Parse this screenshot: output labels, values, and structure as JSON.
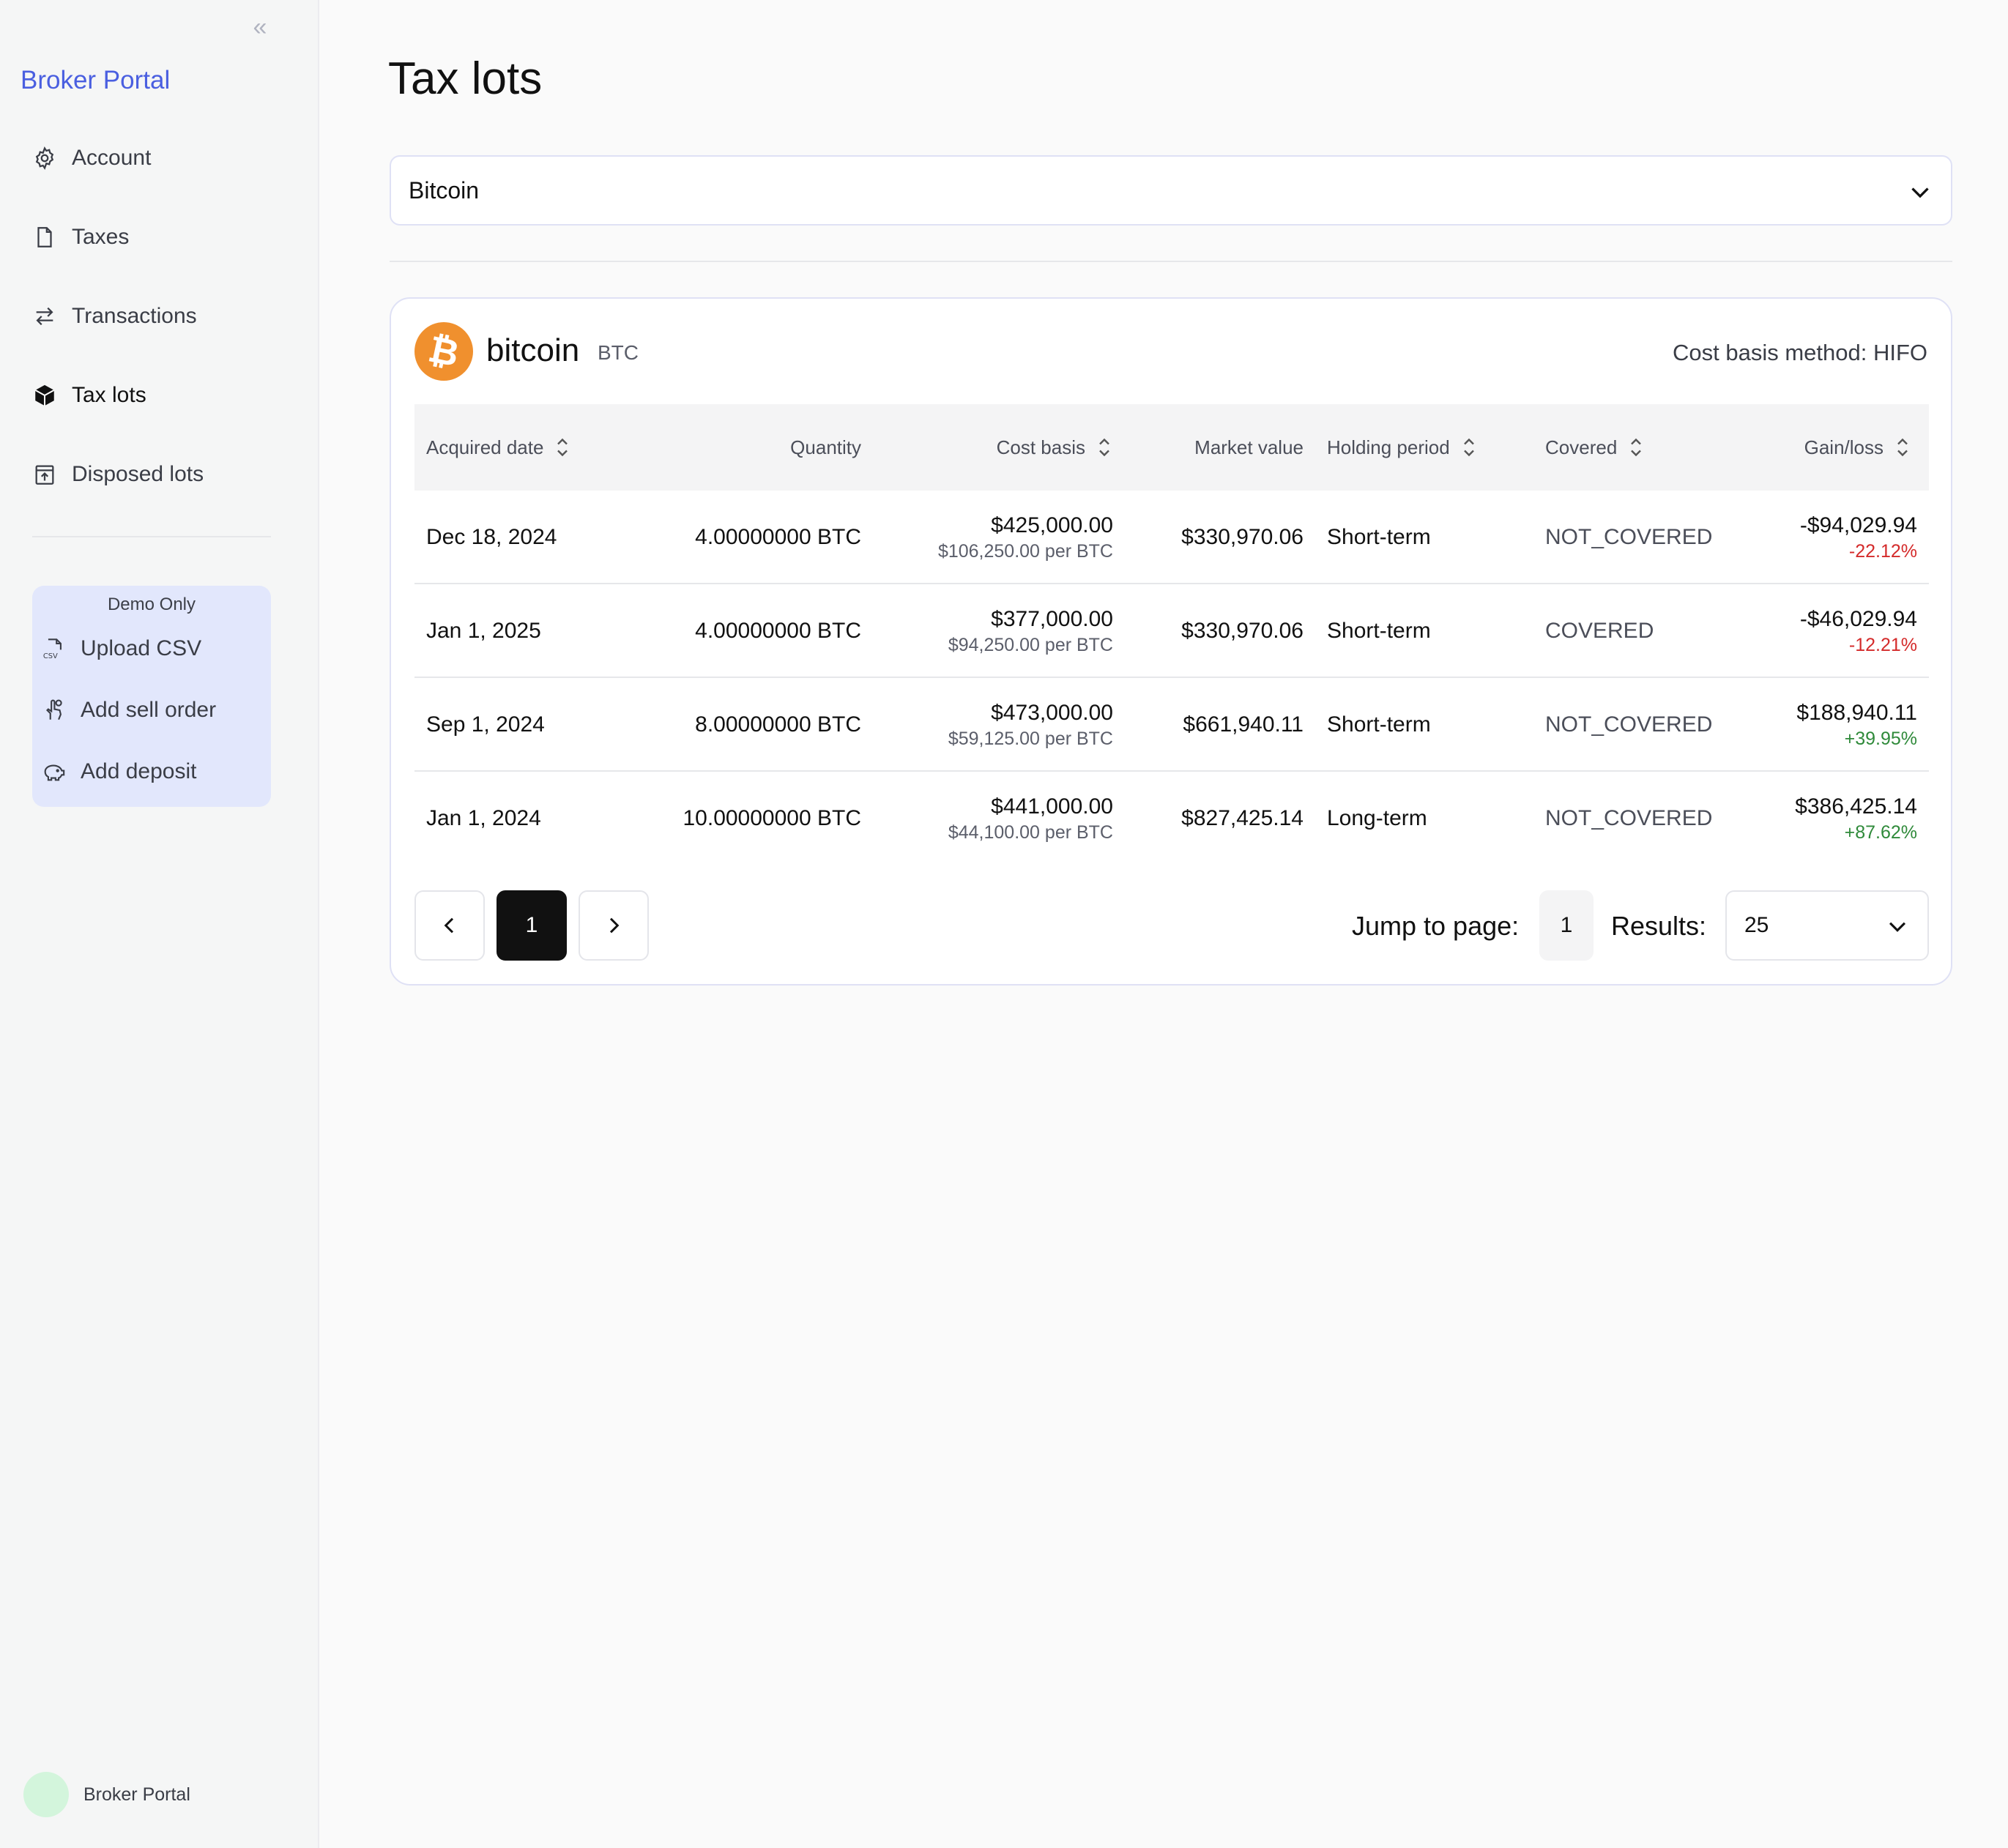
{
  "sidebar": {
    "brand": "Broker Portal",
    "items": [
      {
        "label": "Account",
        "icon": "gear-icon"
      },
      {
        "label": "Taxes",
        "icon": "document-icon"
      },
      {
        "label": "Transactions",
        "icon": "arrows-swap-icon"
      },
      {
        "label": "Tax lots",
        "icon": "cube-icon",
        "active": true
      },
      {
        "label": "Disposed lots",
        "icon": "archive-upload-icon"
      }
    ],
    "demo": {
      "title": "Demo Only",
      "items": [
        {
          "label": "Upload CSV",
          "icon": "csv-file-icon"
        },
        {
          "label": "Add sell order",
          "icon": "hand-coins-icon"
        },
        {
          "label": "Add deposit",
          "icon": "piggy-bank-icon"
        }
      ]
    },
    "footer_name": "Broker Portal"
  },
  "main": {
    "title": "Tax lots",
    "asset_select": {
      "value": "Bitcoin"
    },
    "card": {
      "coin_name": "bitcoin",
      "coin_symbol": "BTC",
      "cost_method": "Cost basis method: HIFO",
      "columns": [
        "Acquired date",
        "Quantity",
        "Cost basis",
        "Market value",
        "Holding period",
        "Covered",
        "Gain/loss"
      ],
      "rows": [
        {
          "date": "Dec 18, 2024",
          "quantity": "4.00000000 BTC",
          "cost": "$425,000.00",
          "cost_per": "$106,250.00 per BTC",
          "market": "$330,970.06",
          "holding": "Short-term",
          "covered": "NOT_COVERED",
          "gain": "-$94,029.94",
          "gain_pct": "-22.12%"
        },
        {
          "date": "Jan 1, 2025",
          "quantity": "4.00000000 BTC",
          "cost": "$377,000.00",
          "cost_per": "$94,250.00 per BTC",
          "market": "$330,970.06",
          "holding": "Short-term",
          "covered": "COVERED",
          "gain": "-$46,029.94",
          "gain_pct": "-12.21%"
        },
        {
          "date": "Sep 1, 2024",
          "quantity": "8.00000000 BTC",
          "cost": "$473,000.00",
          "cost_per": "$59,125.00 per BTC",
          "market": "$661,940.11",
          "holding": "Short-term",
          "covered": "NOT_COVERED",
          "gain": "$188,940.11",
          "gain_pct": "+39.95%"
        },
        {
          "date": "Jan 1, 2024",
          "quantity": "10.00000000 BTC",
          "cost": "$441,000.00",
          "cost_per": "$44,100.00 per BTC",
          "market": "$827,425.14",
          "holding": "Long-term",
          "covered": "NOT_COVERED",
          "gain": "$386,425.14",
          "gain_pct": "+87.62%"
        }
      ],
      "pagination": {
        "current_page": "1",
        "jump_label": "Jump to page:",
        "jump_value": "1",
        "results_label": "Results:",
        "results_value": "25"
      }
    }
  },
  "colors": {
    "accent": "#4a5fe0",
    "bitcoin": "#f0902e",
    "negative": "#d42a2a",
    "positive": "#2f8a3a"
  }
}
